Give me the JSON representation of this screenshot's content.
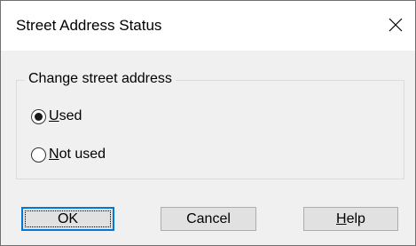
{
  "dialog": {
    "title": "Street Address Status",
    "close_icon": "close-icon"
  },
  "group": {
    "legend": "Change street address",
    "options": [
      {
        "mnemonic": "U",
        "rest": "sed",
        "selected": true
      },
      {
        "mnemonic": "N",
        "rest": "ot used",
        "selected": false
      }
    ]
  },
  "buttons": {
    "ok": "OK",
    "cancel": "Cancel",
    "help_mnemonic": "H",
    "help_rest": "elp"
  },
  "colors": {
    "title_bg": "#ffffff",
    "dialog_bg": "#f0f0f0",
    "default_button_border": "#0078d7"
  }
}
